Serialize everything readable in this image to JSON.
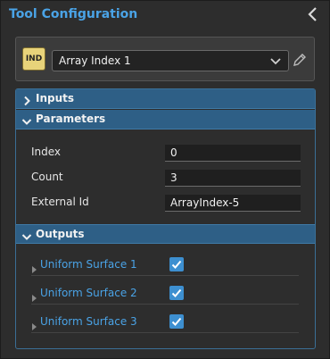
{
  "panel": {
    "title": "Tool Configuration",
    "collapse_icon": "chevron-left-icon",
    "accent_color": "#4aa3e6"
  },
  "tool": {
    "badge": "IND",
    "selected": "Array Index 1",
    "edit_icon": "pencil-icon"
  },
  "sections": {
    "inputs": "Inputs",
    "parameters": "Parameters",
    "outputs": "Outputs"
  },
  "parameters": {
    "index_label": "Index",
    "index_value": "0",
    "count_label": "Count",
    "count_value": "3",
    "external_label": "External Id",
    "external_value": "ArrayIndex-5"
  },
  "outputs": [
    {
      "label": "Uniform Surface 1",
      "checked": true
    },
    {
      "label": "Uniform Surface 2",
      "checked": true
    },
    {
      "label": "Uniform Surface 3",
      "checked": true
    }
  ]
}
